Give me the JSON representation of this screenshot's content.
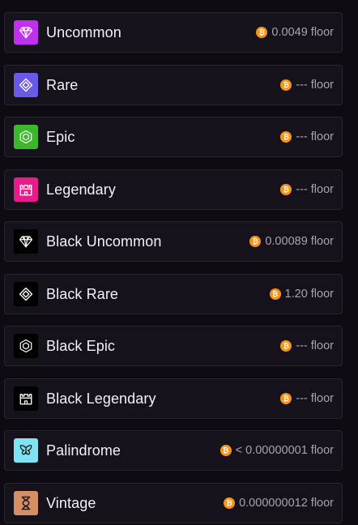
{
  "rarities": [
    {
      "name": "Uncommon",
      "floor": "0.0049 floor",
      "icon": "gem-icon",
      "icon_bg": "#c030f0"
    },
    {
      "name": "Rare",
      "floor": "--- floor",
      "icon": "diamond-icon",
      "icon_bg": "#6a5ae8"
    },
    {
      "name": "Epic",
      "floor": "--- floor",
      "icon": "hexagon-icon",
      "icon_bg": "#3cb82c"
    },
    {
      "name": "Legendary",
      "floor": "--- floor",
      "icon": "castle-icon",
      "icon_bg": "#ea1a8a"
    },
    {
      "name": "Black Uncommon",
      "floor": "0.00089 floor",
      "icon": "gem-icon",
      "icon_bg": "#000000"
    },
    {
      "name": "Black Rare",
      "floor": "1.20 floor",
      "icon": "diamond-icon",
      "icon_bg": "#000000"
    },
    {
      "name": "Black Epic",
      "floor": "--- floor",
      "icon": "hexagon-icon",
      "icon_bg": "#000000"
    },
    {
      "name": "Black Legendary",
      "floor": "--- floor",
      "icon": "castle-icon",
      "icon_bg": "#000000"
    },
    {
      "name": "Palindrome",
      "floor": "< 0.00000001 floor",
      "icon": "butterfly-icon",
      "icon_bg": "#7ee4f4"
    },
    {
      "name": "Vintage",
      "floor": "0.000000012 floor",
      "icon": "hourglass-icon",
      "icon_bg": "#d68e64"
    }
  ],
  "currency": {
    "icon": "bitcoin-icon",
    "color": "#f7931a",
    "glyph": "₿"
  }
}
